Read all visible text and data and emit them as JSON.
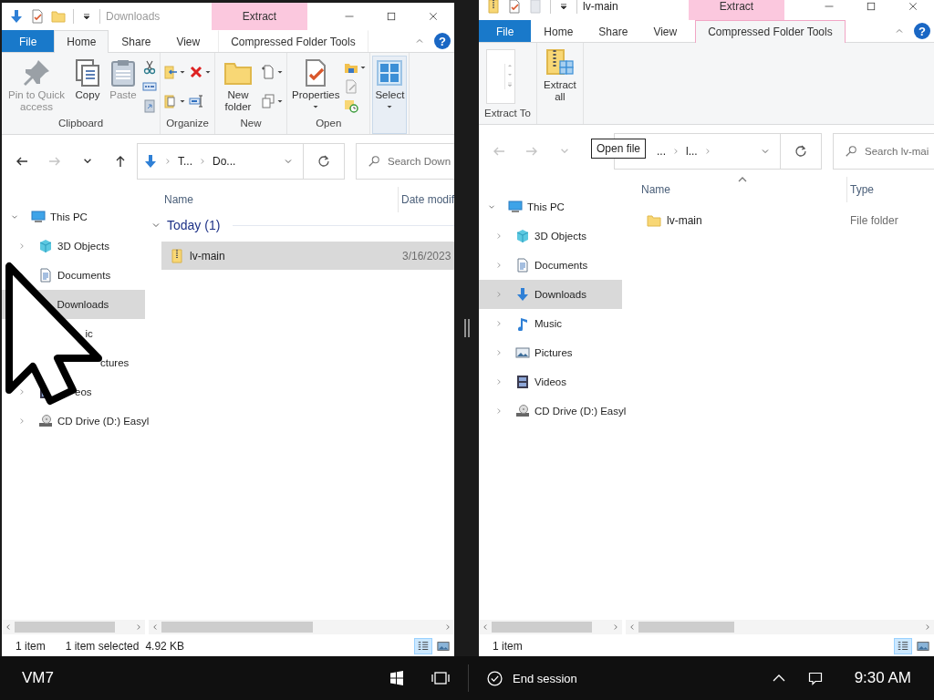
{
  "windows": [
    {
      "title": "Downloads",
      "active": false,
      "quick_access": [
        {
          "kind": "downloads"
        },
        {
          "kind": "properties"
        },
        {
          "kind": "new-folder"
        }
      ],
      "contextual_tab": "Extract",
      "help": "?",
      "tabs": [
        {
          "label": "File",
          "kind": "file",
          "selected": false
        },
        {
          "label": "Home",
          "kind": "tab",
          "selected": true
        },
        {
          "label": "Share",
          "kind": "tab",
          "selected": false
        },
        {
          "label": "View",
          "kind": "tab",
          "selected": false
        },
        {
          "label": "Compressed Folder Tools",
          "kind": "contextual",
          "selected": false
        }
      ],
      "ribbon_groups": [
        {
          "label": "Clipboard",
          "buttons": [
            {
              "kind": "pin",
              "label": "Pin to Quick access",
              "disabled": true,
              "highlighted": false,
              "dropdown": false
            },
            {
              "kind": "copy",
              "label": "Copy",
              "disabled": false,
              "highlighted": false,
              "dropdown": false
            },
            {
              "kind": "paste",
              "label": "Paste",
              "disabled": true,
              "highlighted": false,
              "dropdown": false
            }
          ],
          "small_columns": [
            [
              {
                "kind": "cut",
                "dropdown": false
              },
              {
                "kind": "copy-path",
                "dropdown": false
              },
              {
                "kind": "paste-shortcut",
                "dropdown": false
              }
            ]
          ]
        },
        {
          "label": "Organize",
          "small_columns": [
            [
              {
                "kind": "move-to",
                "dropdown": true
              },
              {
                "kind": "copy-to",
                "dropdown": true
              }
            ],
            [
              {
                "kind": "delete",
                "dropdown": true
              },
              {
                "kind": "rename",
                "dropdown": false
              }
            ]
          ]
        },
        {
          "label": "New",
          "buttons": [
            {
              "kind": "new-folder",
              "label": "New folder",
              "disabled": false,
              "highlighted": false,
              "dropdown": false
            }
          ],
          "small_columns": [
            [
              {
                "kind": "new-item",
                "dropdown": true
              },
              {
                "kind": "easy-access",
                "dropdown": true
              }
            ]
          ]
        },
        {
          "label": "Open",
          "buttons": [
            {
              "kind": "properties",
              "label": "Properties",
              "disabled": false,
              "highlighted": false,
              "dropdown": true
            }
          ],
          "small_columns": [
            [
              {
                "kind": "open",
                "dropdown": true
              },
              {
                "kind": "edit",
                "dropdown": false
              },
              {
                "kind": "history",
                "dropdown": false
              }
            ]
          ]
        },
        {
          "buttons": [
            {
              "kind": "select",
              "label": "Select",
              "disabled": false,
              "highlighted": true,
              "dropdown": true
            }
          ]
        }
      ],
      "nav_buttons": [
        {
          "kind": "back",
          "disabled": false
        },
        {
          "kind": "forward",
          "disabled": true
        },
        {
          "kind": "recent",
          "disabled": false
        },
        {
          "kind": "up",
          "disabled": false
        }
      ],
      "address": {
        "location_icon": true,
        "leading_separator": true,
        "breadcrumbs": [
          "T...",
          "Do..."
        ],
        "trailing_separator": false
      },
      "search": {
        "placeholder": "Search Down"
      },
      "tree": [
        {
          "label": "This PC",
          "kind": "pc",
          "expanded": true,
          "selected": false,
          "children": [
            {
              "label": "3D Objects",
              "kind": "cube",
              "expanded": false,
              "selected": false
            },
            {
              "label": "Documents",
              "kind": "documents",
              "expanded": false,
              "selected": false
            },
            {
              "label": "Downloads",
              "selected": true
            },
            {
              "label": "ic",
              "selected": false
            },
            {
              "label": "ctures",
              "selected": false
            },
            {
              "label": "eos",
              "kind": "videos",
              "expanded": false,
              "selected": false
            },
            {
              "label": "CD Drive (D:) Easyl",
              "kind": "cd",
              "expanded": false,
              "selected": false
            }
          ]
        }
      ],
      "columns": [
        {
          "label": "Name"
        },
        {
          "label": "Date modif"
        }
      ],
      "groups": [
        {
          "label": "Today (1)",
          "expanded": true,
          "rows": [
            {
              "kind": "zip",
              "cells": [
                "lv-main",
                "3/16/2023"
              ],
              "selected": true
            }
          ]
        }
      ],
      "status": [
        "1 item",
        "1 item selected",
        "4.92 KB"
      ],
      "views": [
        {
          "kind": "details",
          "selected": true
        },
        {
          "kind": "large-icons",
          "selected": false
        }
      ]
    },
    {
      "title": "lv-main",
      "active": true,
      "quick_access": [
        {
          "kind": "zip"
        },
        {
          "kind": "properties"
        },
        {
          "kind": "blank-page"
        }
      ],
      "contextual_tab": "Extract",
      "help": "?",
      "tabs": [
        {
          "label": "File",
          "kind": "file",
          "selected": false
        },
        {
          "label": "Home",
          "kind": "tab",
          "selected": false
        },
        {
          "label": "Share",
          "kind": "tab",
          "selected": false
        },
        {
          "label": "View",
          "kind": "tab",
          "selected": false
        },
        {
          "label": "Compressed Folder Tools",
          "kind": "contextual",
          "selected": true
        }
      ],
      "ribbon_groups": [
        {
          "label": "Extract To",
          "buttons": [
            {
              "kind": "gallery"
            }
          ]
        },
        {
          "buttons": [
            {
              "kind": "extract",
              "label": "Extract all",
              "disabled": false,
              "highlighted": false,
              "dropdown": false
            }
          ]
        }
      ],
      "nav_buttons": [
        {
          "kind": "back",
          "disabled": true
        },
        {
          "kind": "forward",
          "disabled": true
        },
        {
          "kind": "recent",
          "disabled": true
        }
      ],
      "address": {
        "location_icon": false,
        "leading_separator": false,
        "breadcrumbs": [
          "...",
          "l..."
        ],
        "trailing_separator": true
      },
      "tooltip": "Open file",
      "search": {
        "placeholder": "Search lv-mai"
      },
      "tree": [
        {
          "label": "This PC",
          "kind": "pc",
          "expanded": true,
          "selected": false,
          "children": [
            {
              "label": "3D Objects",
              "kind": "cube",
              "expanded": false,
              "selected": false
            },
            {
              "label": "Documents",
              "kind": "documents",
              "expanded": false,
              "selected": false
            },
            {
              "label": "Downloads",
              "kind": "downloads",
              "expanded": false,
              "selected": true
            },
            {
              "label": "Music",
              "kind": "music",
              "expanded": false,
              "selected": false
            },
            {
              "label": "Pictures",
              "kind": "pictures",
              "expanded": false,
              "selected": false
            },
            {
              "label": "Videos",
              "kind": "videos",
              "expanded": false,
              "selected": false
            },
            {
              "label": "CD Drive (D:) Easyl",
              "kind": "cd",
              "expanded": false,
              "selected": false
            }
          ]
        }
      ],
      "columns": [
        {
          "label": "Name",
          "sorted_ascending": true
        },
        {
          "label": "Type"
        }
      ],
      "rows": [
        {
          "kind": "folder",
          "cells": [
            "lv-main",
            "File folder"
          ],
          "selected": false
        }
      ],
      "status": [
        "1 item"
      ],
      "views": [
        {
          "kind": "details",
          "selected": true
        },
        {
          "kind": "large-icons",
          "selected": false
        }
      ]
    }
  ],
  "taskbar": {
    "session_label": "VM7",
    "end_session": "End session",
    "clock": "9:30 AM"
  }
}
